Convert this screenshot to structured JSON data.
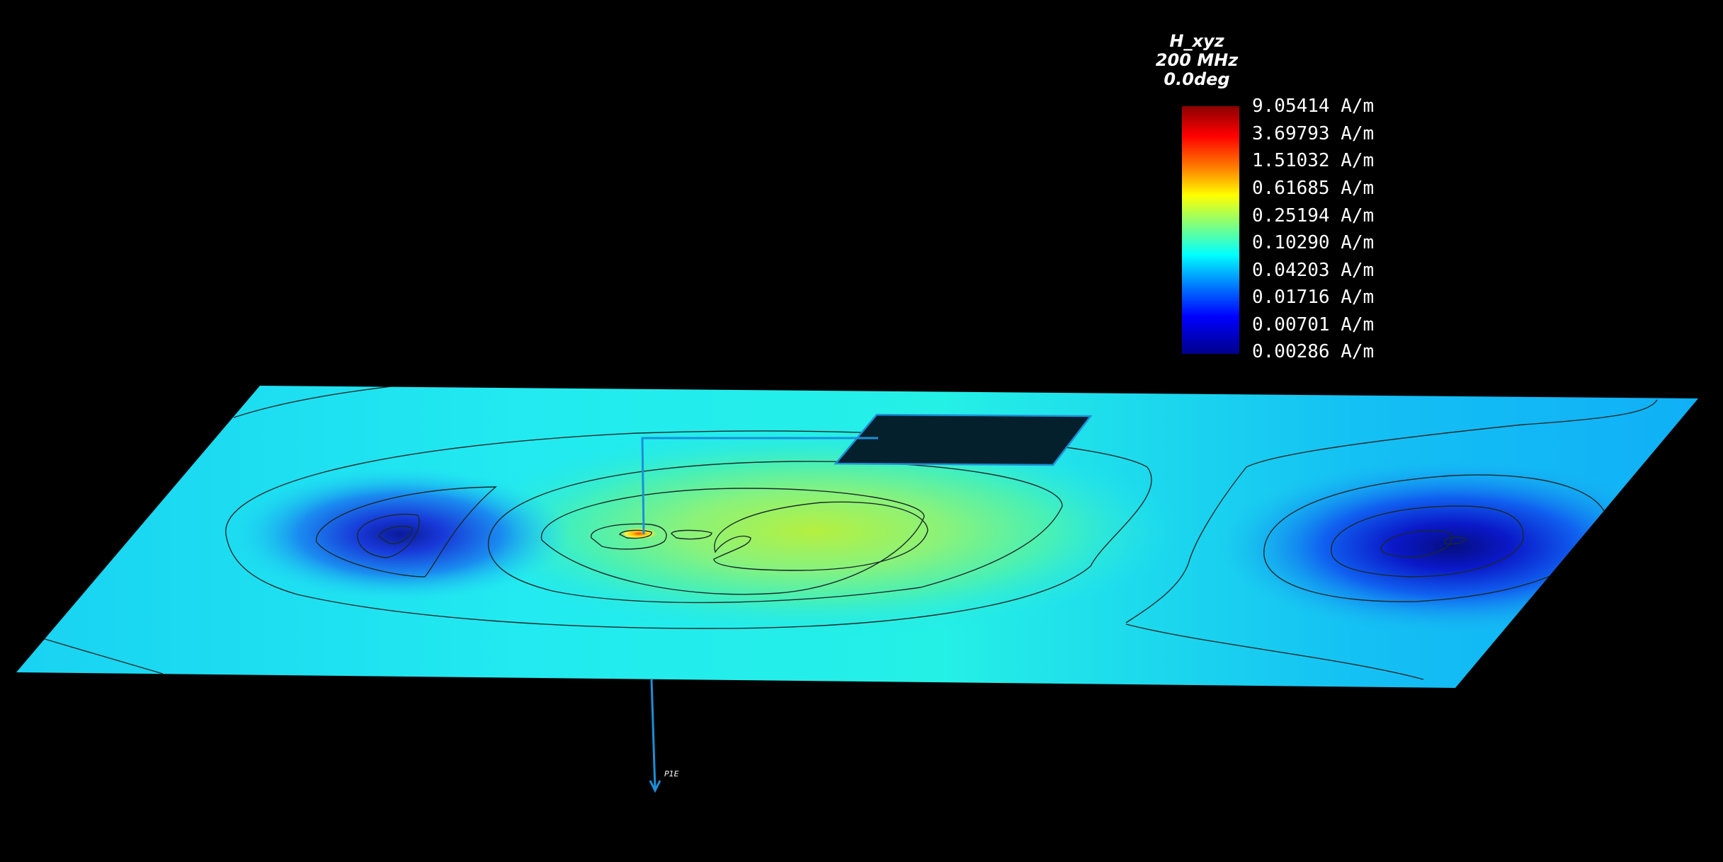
{
  "legend": {
    "quantity": "H_xyz",
    "frequency": "200 MHz",
    "phase": "0.0deg",
    "levels": [
      "9.05414 A/m",
      "3.69793 A/m",
      "1.51032 A/m",
      "0.61685 A/m",
      "0.25194 A/m",
      "0.10290 A/m",
      "0.04203 A/m",
      "0.01716 A/m",
      "0.00701 A/m",
      "0.00286 A/m"
    ],
    "colormap": [
      "#8b0000",
      "#ff0000",
      "#ff7f00",
      "#ffff00",
      "#7fff7f",
      "#00ffff",
      "#007fff",
      "#0000ff",
      "#00008b"
    ]
  },
  "scene": {
    "ground_plane_color": "#1fe6f0",
    "patch_color": "#04202c",
    "feed_line_color": "#1b8fd8",
    "contour_line_color": "#1a2a2a"
  },
  "probe": {
    "label": "P1E"
  }
}
